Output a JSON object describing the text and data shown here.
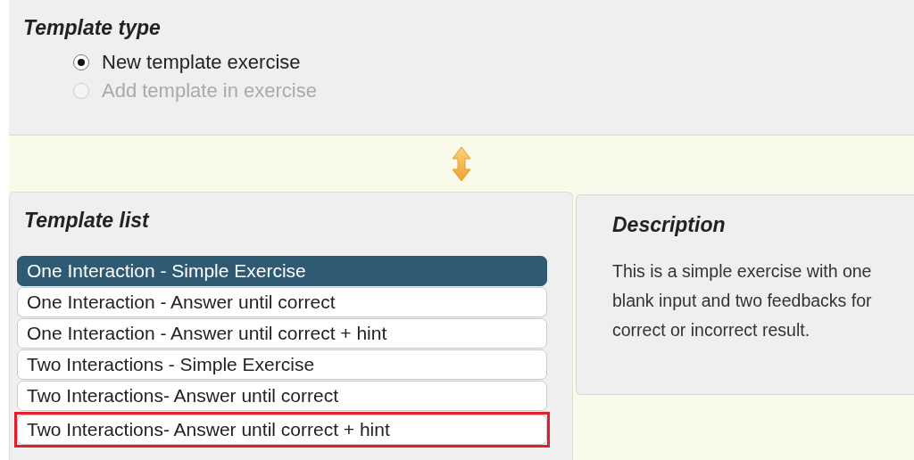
{
  "template_type": {
    "title": "Template type",
    "options": [
      {
        "label": "New template exercise",
        "selected": true,
        "disabled": false
      },
      {
        "label": "Add template in exercise",
        "selected": false,
        "disabled": true
      }
    ]
  },
  "template_list": {
    "title": "Template list",
    "items": [
      {
        "label": "One Interaction - Simple Exercise",
        "selected": true,
        "highlighted": false
      },
      {
        "label": "One Interaction - Answer until correct",
        "selected": false,
        "highlighted": false
      },
      {
        "label": "One Interaction - Answer until correct + hint",
        "selected": false,
        "highlighted": false
      },
      {
        "label": "Two Interactions - Simple Exercise",
        "selected": false,
        "highlighted": false
      },
      {
        "label": "Two Interactions- Answer until correct",
        "selected": false,
        "highlighted": false
      },
      {
        "label": "Two Interactions- Answer until correct + hint",
        "selected": false,
        "highlighted": true
      }
    ]
  },
  "description": {
    "title": "Description",
    "text": "This is a simple exercise with one blank input and two feedbacks for correct or incorrect result."
  }
}
